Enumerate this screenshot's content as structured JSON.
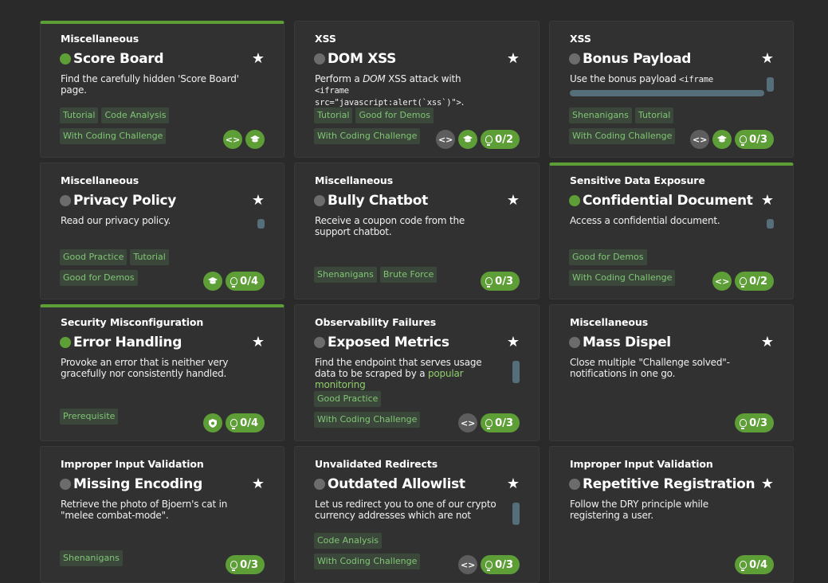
{
  "cards": [
    {
      "category": "Miscellaneous",
      "title": "Score Board",
      "solved": true,
      "desc_html": "Find the carefully hidden 'Score Board' page.",
      "tags": [
        "Tutorial",
        "Code Analysis",
        "With Coding Challenge"
      ],
      "icons": [
        {
          "kind": "code",
          "style": "green",
          "name": "code-icon"
        },
        {
          "kind": "cap",
          "style": "green",
          "name": "graduation-cap-icon"
        }
      ],
      "hint": null
    },
    {
      "category": "XSS",
      "title": "DOM XSS",
      "solved": false,
      "desc_html": "Perform a <em>DOM</em> XSS attack with <code>&lt;iframe src=\"javascript:alert(`xss`)\"&gt;</code>.",
      "tags": [
        "Tutorial",
        "Good for Demos",
        "With Coding Challenge"
      ],
      "icons": [
        {
          "kind": "code",
          "style": "grey",
          "name": "code-icon"
        },
        {
          "kind": "cap",
          "style": "green",
          "name": "graduation-cap-icon"
        }
      ],
      "hint": "0/2"
    },
    {
      "category": "XSS",
      "title": "Bonus Payload",
      "solved": false,
      "desc_html": "Use the bonus payload <code>&lt;iframe</code>",
      "hscroll": true,
      "scroll": 18,
      "tags": [
        "Shenanigans",
        "Tutorial",
        "With Coding Challenge"
      ],
      "icons": [
        {
          "kind": "code",
          "style": "grey",
          "name": "code-icon"
        },
        {
          "kind": "cap",
          "style": "green",
          "name": "graduation-cap-icon"
        }
      ],
      "hint": "0/3"
    },
    {
      "category": "Miscellaneous",
      "title": "Privacy Policy",
      "solved": false,
      "desc_html": "Read our privacy policy.",
      "scroll": 12,
      "tags": [
        "Good Practice",
        "Tutorial",
        "Good for Demos"
      ],
      "icons": [
        {
          "kind": "cap",
          "style": "green",
          "name": "graduation-cap-icon"
        }
      ],
      "hint": "0/4"
    },
    {
      "category": "Miscellaneous",
      "title": "Bully Chatbot",
      "solved": false,
      "desc_html": "Receive a coupon code from the support chatbot.",
      "tags": [
        "Shenanigans",
        "Brute Force"
      ],
      "tags_row2": true,
      "icons": [],
      "hint": "0/3"
    },
    {
      "category": "Sensitive Data Exposure",
      "title": "Confidential Document",
      "solved": true,
      "desc_html": "Access a confidential document.",
      "scroll": 12,
      "tags": [
        "Good for Demos",
        "With Coding Challenge"
      ],
      "tags_stack": true,
      "icons": [
        {
          "kind": "code",
          "style": "green",
          "name": "code-icon"
        }
      ],
      "hint": "0/2"
    },
    {
      "category": "Security Misconfiguration",
      "title": "Error Handling",
      "solved": true,
      "desc_html": "Provoke an error that is neither very gracefully nor consistently handled.",
      "tags": [
        "Prerequisite"
      ],
      "tags_row2": true,
      "icons": [
        {
          "kind": "shield",
          "style": "green",
          "name": "prerequisite-icon"
        }
      ],
      "hint": "0/4"
    },
    {
      "category": "Observability Failures",
      "title": "Exposed Metrics",
      "solved": false,
      "desc_html": "Find the endpoint that serves usage data to be scraped by a <span class=\"lnk\">popular monitoring</span>",
      "scroll": 28,
      "tags": [
        "Good Practice",
        "With Coding Challenge"
      ],
      "tags_stack": true,
      "icons": [
        {
          "kind": "code",
          "style": "grey",
          "name": "code-icon"
        }
      ],
      "hint": "0/3"
    },
    {
      "category": "Miscellaneous",
      "title": "Mass Dispel",
      "solved": false,
      "desc_html": "Close multiple \"Challenge solved\"-notifications in one go.",
      "tags": [],
      "icons": [],
      "hint": "0/3"
    },
    {
      "category": "Improper Input Validation",
      "title": "Missing Encoding",
      "solved": false,
      "desc_html": "Retrieve the photo of Bjoern's cat in \"melee combat-mode\".",
      "tags": [
        "Shenanigans"
      ],
      "tags_row2": true,
      "icons": [],
      "hint": "0/3"
    },
    {
      "category": "Unvalidated Redirects",
      "title": "Outdated Allowlist",
      "solved": false,
      "desc_html": "Let us redirect you to one of our crypto currency addresses which are not",
      "scroll": 28,
      "tags": [
        "Code Analysis",
        "With Coding Challenge"
      ],
      "tags_stack": true,
      "icons": [
        {
          "kind": "code",
          "style": "grey",
          "name": "code-icon"
        }
      ],
      "hint": "0/3"
    },
    {
      "category": "Improper Input Validation",
      "title": "Repetitive Registration",
      "solved": false,
      "desc_html": "Follow the DRY principle while registering a user.",
      "tags": [],
      "icons": [],
      "hint": "0/4"
    }
  ]
}
